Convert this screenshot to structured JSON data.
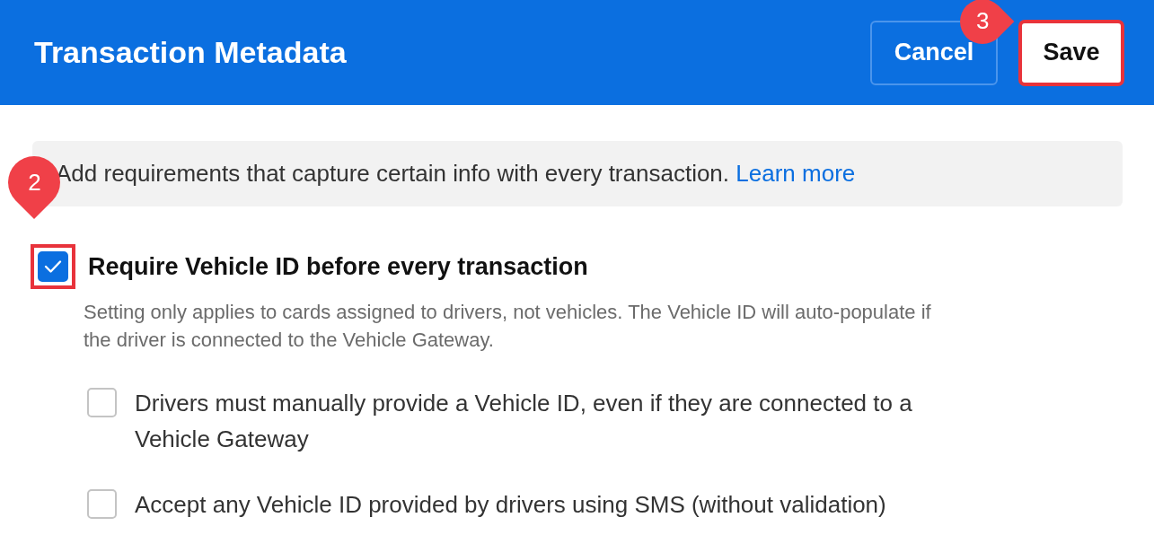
{
  "header": {
    "title": "Transaction Metadata",
    "buttons": [
      {
        "kind": "secondary",
        "label": "Cancel",
        "highlighted": false
      },
      {
        "kind": "primary",
        "label": "Save",
        "highlighted": true,
        "callout": "3"
      }
    ]
  },
  "info": {
    "text": "Add requirements that capture certain info with every transaction.",
    "link": "Learn more"
  },
  "main_option": {
    "label": "Require Vehicle ID before every transaction",
    "checked": true,
    "highlighted": true,
    "callout": "2",
    "description": "Setting only applies to cards assigned to drivers, not vehicles. The Vehicle ID will auto-populate if the driver is connected to the Vehicle Gateway."
  },
  "sub_options": [
    {
      "label": "Drivers must manually provide a Vehicle ID, even if they are connected to a Vehicle Gateway",
      "checked": false
    },
    {
      "label": "Accept any Vehicle ID provided by drivers using SMS (without validation)",
      "checked": false
    }
  ]
}
